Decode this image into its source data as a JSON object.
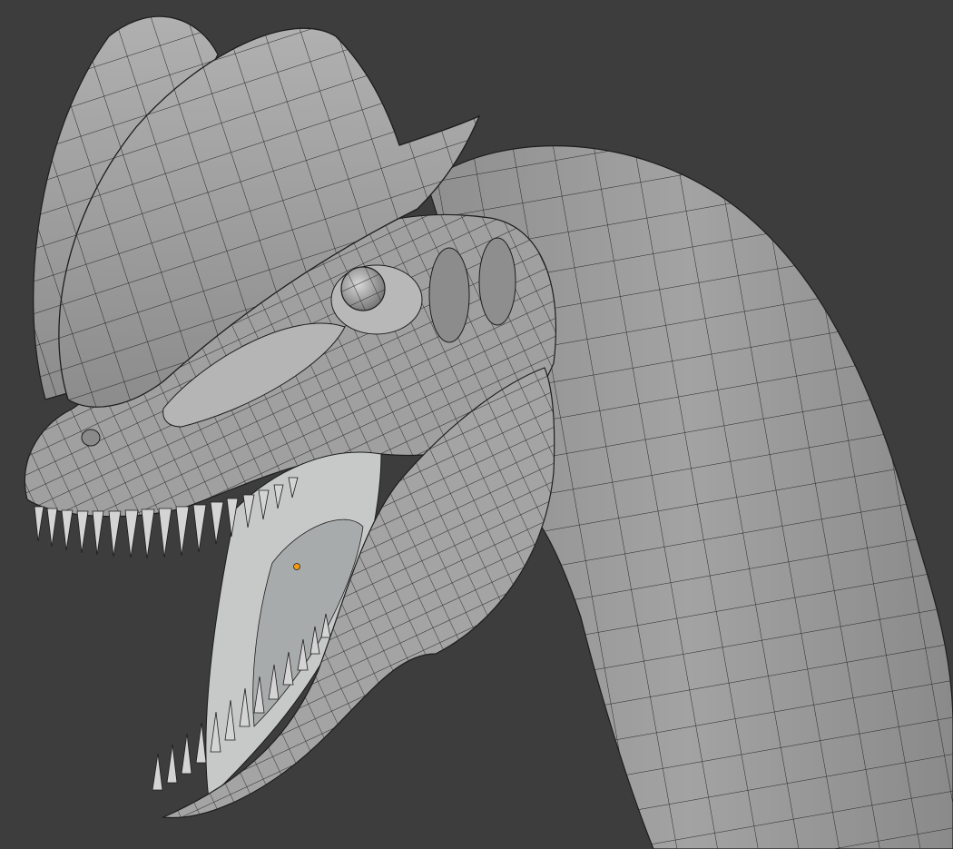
{
  "viewport": {
    "background": "#3d3d3d",
    "mesh_fill": "#9d9d9d",
    "mesh_shade": "#7f7f7f",
    "mesh_highlight": "#c4c4c4",
    "wire_color": "#1d1d1d",
    "origin_color": "#f39c12",
    "subject": "dilophosaurus-head-wireframe-mesh"
  }
}
